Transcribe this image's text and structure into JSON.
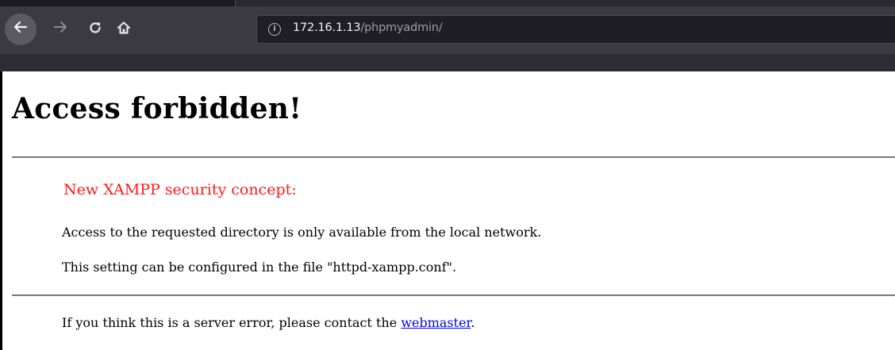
{
  "browser": {
    "url_host": "172.16.1.13",
    "url_path": "/phpmyadmin/",
    "icons": {
      "back": "back-arrow-icon",
      "forward": "forward-arrow-icon",
      "reload": "reload-icon",
      "home": "home-icon",
      "site_info": "info-icon"
    },
    "colors": {
      "chrome_bg": "#2b2a33",
      "toolbar_bg": "#3b3a42",
      "urlbar_bg": "#1f1e25"
    }
  },
  "page": {
    "title": "Access forbidden!",
    "subhead": "New XAMPP security concept:",
    "para1": "Access to the requested directory is only available from the local network.",
    "para2": "This setting can be configured in the file \"httpd-xampp.conf\".",
    "para3_prefix": "If you think this is a server error, please contact the ",
    "para3_link": "webmaster",
    "para3_suffix": ".",
    "colors": {
      "subhead": "#ff1a1a",
      "link": "#0000ee"
    }
  }
}
